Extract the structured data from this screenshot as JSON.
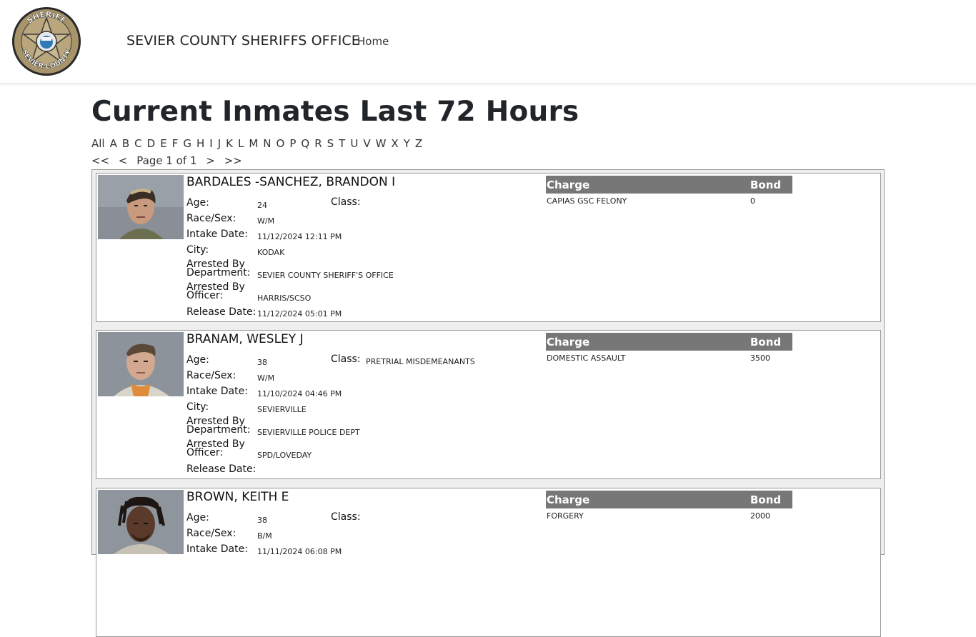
{
  "header": {
    "brand": "SEVIER COUNTY SHERIFFS OFFICE",
    "home_link": "Home",
    "logo_top_text": "SHERIFF",
    "logo_bottom_text": "SEVIER COUNTY"
  },
  "page": {
    "title": "Current Inmates Last 72 Hours",
    "letters": [
      "All",
      "A",
      "B",
      "C",
      "D",
      "E",
      "F",
      "G",
      "H",
      "I",
      "J",
      "K",
      "L",
      "M",
      "N",
      "O",
      "P",
      "Q",
      "R",
      "S",
      "T",
      "U",
      "V",
      "W",
      "X",
      "Y",
      "Z"
    ],
    "pager": {
      "first": "<<",
      "prev": "<",
      "label": "Page 1 of 1",
      "next": ">",
      "last": ">>"
    }
  },
  "labels": {
    "age": "Age:",
    "class": "Class:",
    "race_sex": "Race/Sex:",
    "intake_date": "Intake Date:",
    "city": "City:",
    "arrested_dept": "Arrested By Department:",
    "arrested_officer": "Arrested By Officer:",
    "release_date": "Release Date:",
    "charge": "Charge",
    "bond": "Bond"
  },
  "inmates": [
    {
      "name": "BARDALES -SANCHEZ, BRANDON I",
      "age": "24",
      "class": "",
      "race_sex": "W/M",
      "intake_date": "11/12/2024 12:11 PM",
      "city": "KODAK",
      "department": "SEVIER COUNTY SHERIFF'S OFFICE",
      "officer": "HARRIS/SCSO",
      "release_date": "11/12/2024 05:01 PM",
      "charge": "CAPIAS GSC FELONY",
      "bond": "0"
    },
    {
      "name": "BRANAM, WESLEY J",
      "age": "38",
      "class": "PRETRIAL MISDEMEANANTS",
      "race_sex": "W/M",
      "intake_date": "11/10/2024 04:46 PM",
      "city": "SEVIERVILLE",
      "department": "SEVIERVILLE POLICE DEPT",
      "officer": "SPD/LOVEDAY",
      "release_date": "",
      "charge": "DOMESTIC ASSAULT",
      "bond": "3500"
    },
    {
      "name": "BROWN, KEITH E",
      "age": "38",
      "class": "",
      "race_sex": "B/M",
      "intake_date": "11/11/2024 06:08 PM",
      "city": "",
      "department": "",
      "officer": "",
      "release_date": "",
      "charge": "FORGERY",
      "bond": "2000"
    }
  ]
}
